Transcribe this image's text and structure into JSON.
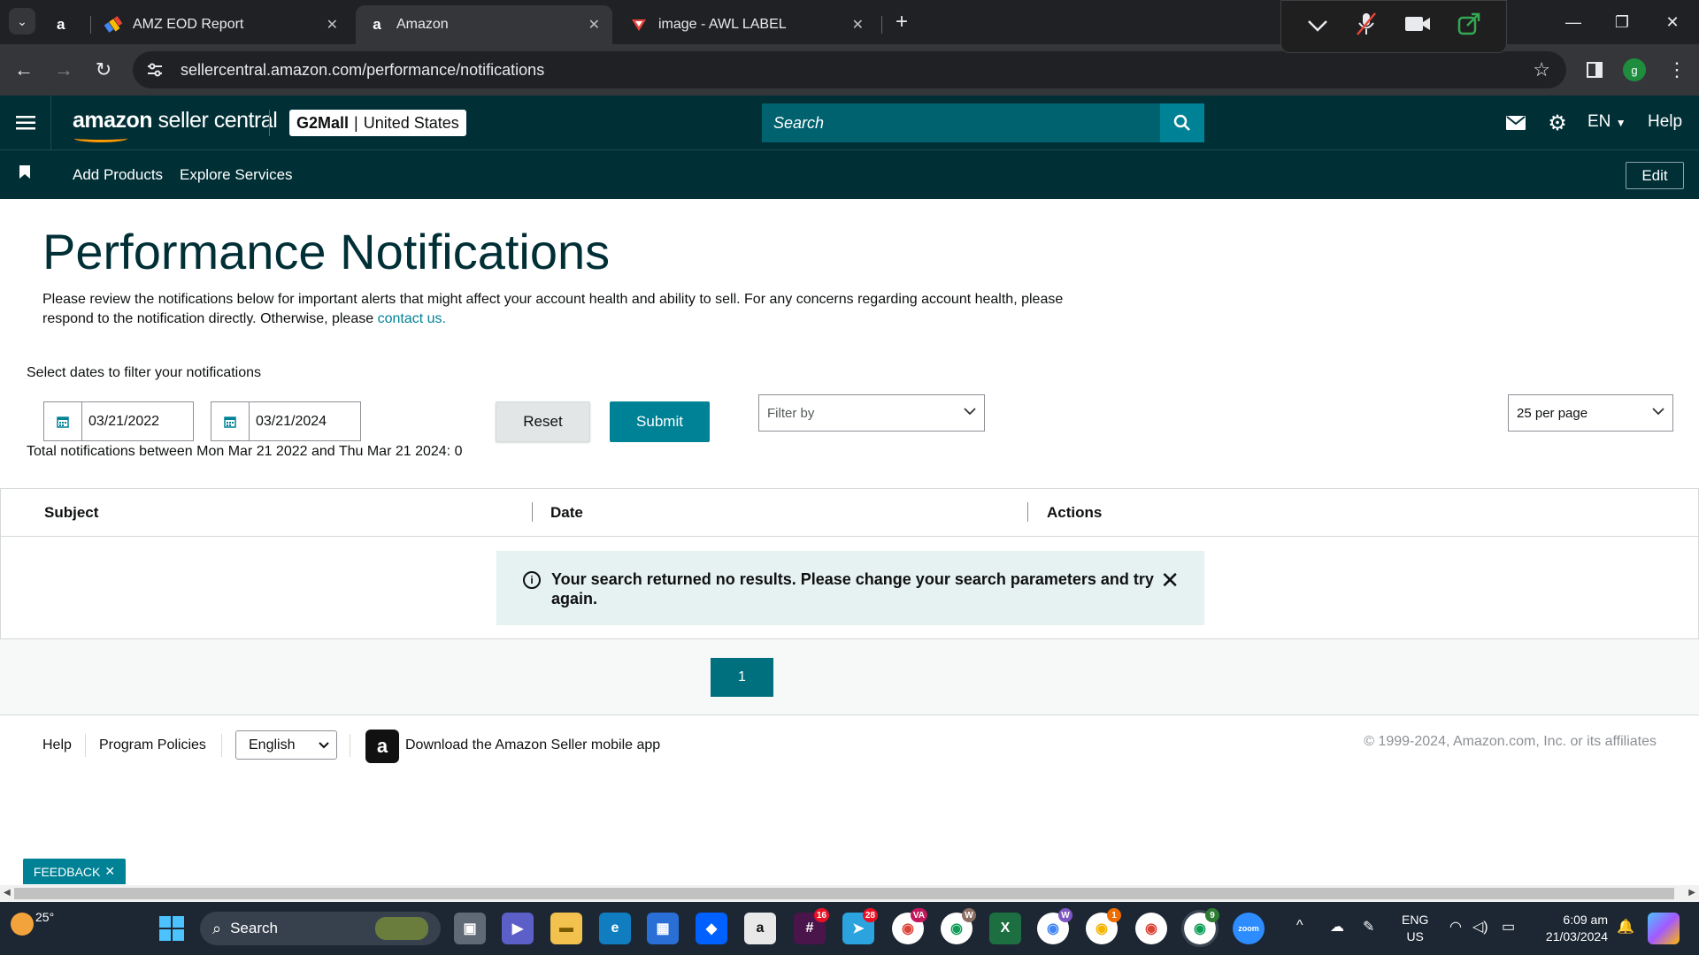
{
  "browser": {
    "tabs": [
      {
        "favicon": "a",
        "title": ""
      },
      {
        "favicon": "eod-icon",
        "title": "AMZ EOD Report"
      },
      {
        "favicon": "a",
        "title": "Amazon"
      },
      {
        "favicon": "pdf-icon",
        "title": "image - AWL LABEL"
      }
    ],
    "url": "sellercentral.amazon.com/performance/notifications",
    "profile_initial": "g"
  },
  "header": {
    "logo_brand": "amazon",
    "logo_product": " seller central",
    "store_name": "G2Mall",
    "store_separator": "|",
    "marketplace": "United States",
    "search_placeholder": "Search",
    "language": "EN",
    "help": "Help"
  },
  "subnav": {
    "links": [
      "Add Products",
      "Explore Services"
    ],
    "edit": "Edit"
  },
  "page": {
    "title": "Performance Notifications",
    "intro": "Please review the notifications below for important alerts that might affect your account health and ability to sell. For any concerns regarding account health, please respond to the notification directly. Otherwise, please ",
    "intro_link": "contact us."
  },
  "filters": {
    "label": "Select dates to filter your notifications",
    "start_date": "03/21/2022",
    "end_date": "03/21/2024",
    "reset": "Reset",
    "submit": "Submit",
    "filter_by": "Filter by",
    "per_page": "25 per page",
    "total_text": "Total notifications between Mon Mar 21 2022 and Thu Mar 21 2024: 0"
  },
  "table": {
    "columns": [
      "Subject",
      "Date",
      "Actions"
    ],
    "empty_message": "Your search returned no results. Please change your search parameters and try again."
  },
  "pagination": {
    "current_page": "1"
  },
  "footer": {
    "help": "Help",
    "policies": "Program Policies",
    "language": "English",
    "app_download": "Download the Amazon Seller mobile app",
    "copyright": "© 1999-2024, Amazon.com, Inc. or its affiliates"
  },
  "feedback": "FEEDBACK",
  "taskbar": {
    "temperature": "25°",
    "search": "Search",
    "apps": [
      {
        "name": "slack",
        "badge": "16"
      },
      {
        "name": "telegram",
        "badge": "28"
      },
      {
        "name": "chrome-va",
        "badge": "VA"
      },
      {
        "name": "chrome-w",
        "badge": "W"
      },
      {
        "name": "chrome-w2",
        "badge": "W"
      },
      {
        "name": "chrome-1",
        "badge": "1"
      },
      {
        "name": "chrome-9",
        "badge": "9"
      }
    ],
    "lang_line1": "ENG",
    "lang_line2": "US",
    "time": "6:09 am",
    "date": "21/03/2024"
  }
}
